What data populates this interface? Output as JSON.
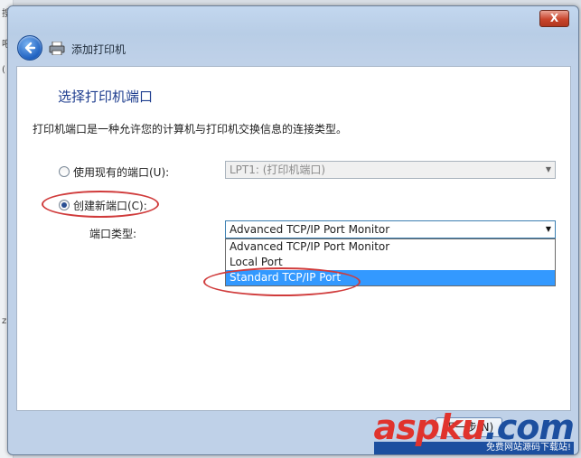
{
  "background": {
    "left_fragments": [
      "搜",
      "吧",
      "(",
      "z"
    ]
  },
  "window": {
    "close_label": "X",
    "header_title": "添加打印机",
    "page_title": "选择打印机端口",
    "description": "打印机端口是一种允许您的计算机与打印机交换信息的连接类型。",
    "use_existing": {
      "label": "使用现有的端口(U):",
      "value": "LPT1: (打印机端口)",
      "checked": false
    },
    "create_new": {
      "label": "创建新端口(C):",
      "checked": true
    },
    "port_type": {
      "label": "端口类型:",
      "value": "Advanced TCP/IP Port Monitor",
      "options": [
        "Advanced TCP/IP Port Monitor",
        "Local Port",
        "Standard TCP/IP Port"
      ],
      "highlighted": "Standard TCP/IP Port"
    },
    "next_label": "下一步(N)"
  },
  "watermark": {
    "text": "aspku",
    "dot_com": ".com",
    "subtitle": "免费网站源码下载站!"
  },
  "colors": {
    "title_blue": "#1f3e8f",
    "selection": "#3399ff",
    "annotation_red": "#d03b3b",
    "close_red": "#c9452c"
  }
}
